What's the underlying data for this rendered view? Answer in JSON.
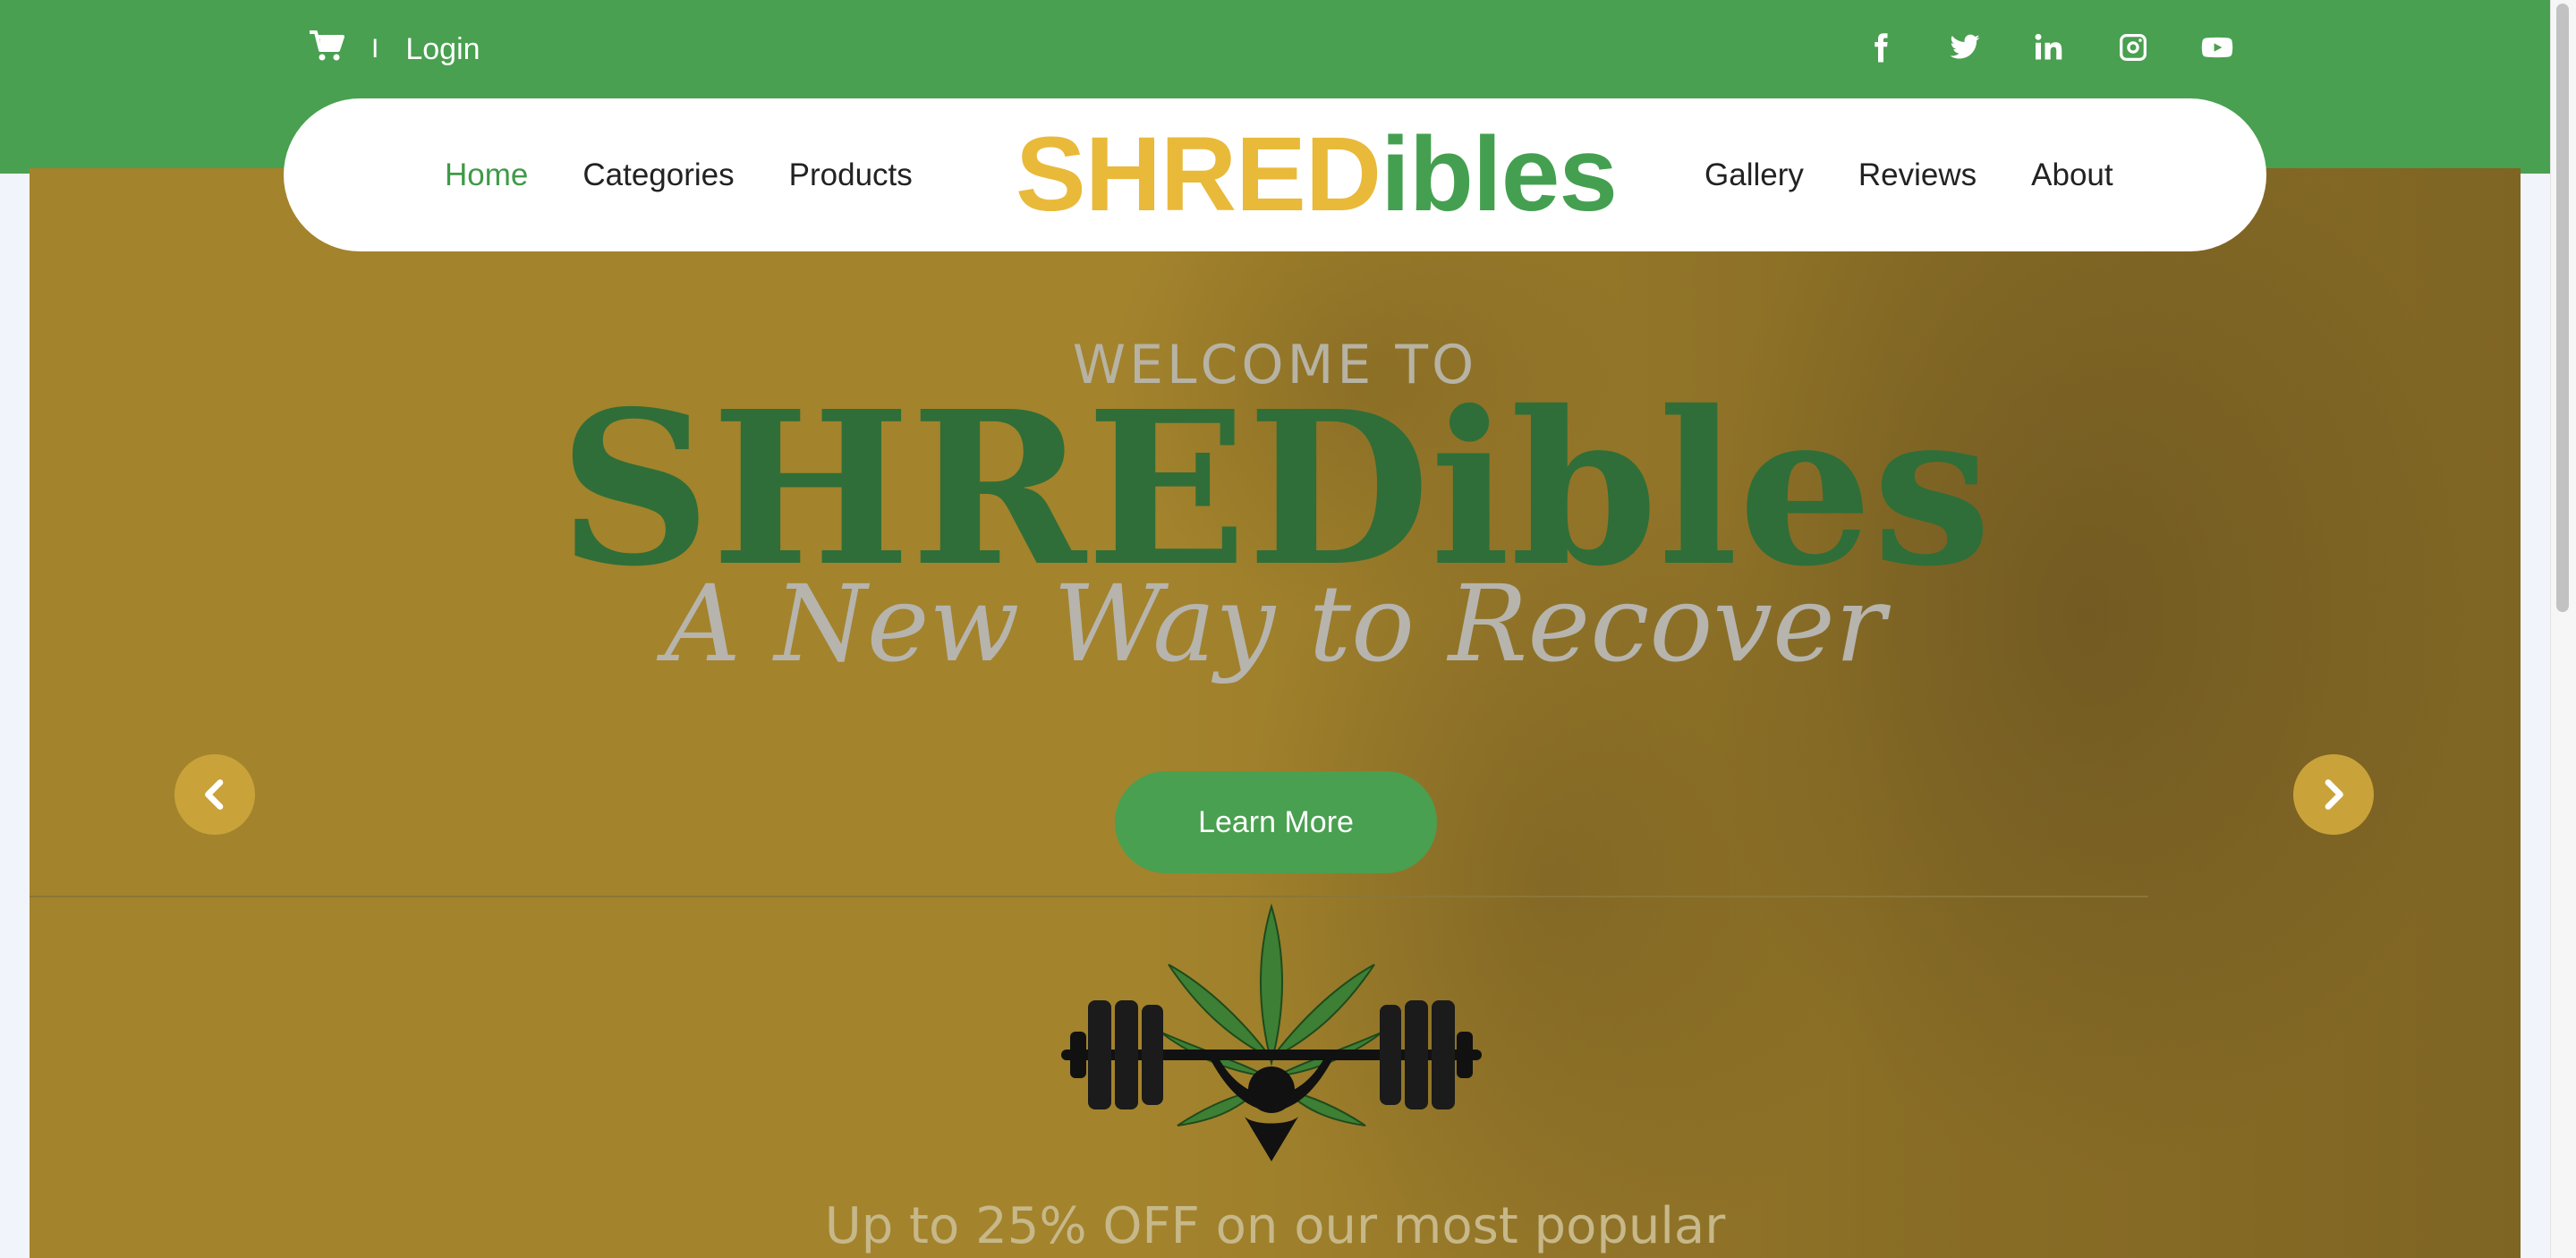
{
  "topbar": {
    "cart_icon": "shopping-cart-icon",
    "separator": "I",
    "login_label": "Login",
    "socials": [
      "facebook-icon",
      "twitter-icon",
      "linkedin-icon",
      "instagram-icon",
      "youtube-icon"
    ]
  },
  "nav": {
    "left_items": [
      "Home",
      "Categories",
      "Products"
    ],
    "right_items": [
      "Gallery",
      "Reviews",
      "About"
    ],
    "active": "Home",
    "brand_part1": "SHRED",
    "brand_part2": "ibles"
  },
  "hero": {
    "welcome": "WELCOME TO",
    "title": "SHREDibles",
    "tagline": "A New Way to Recover",
    "button_label": "Learn More",
    "promo": "Up to 25% OFF on our most popular",
    "prev_icon": "chevron-left-icon",
    "next_icon": "chevron-right-icon"
  },
  "colors": {
    "brand_green": "#49a050",
    "brand_yellow": "#e9b93a",
    "hero_bg": "#a3832c",
    "title_green": "#2f6e38"
  }
}
